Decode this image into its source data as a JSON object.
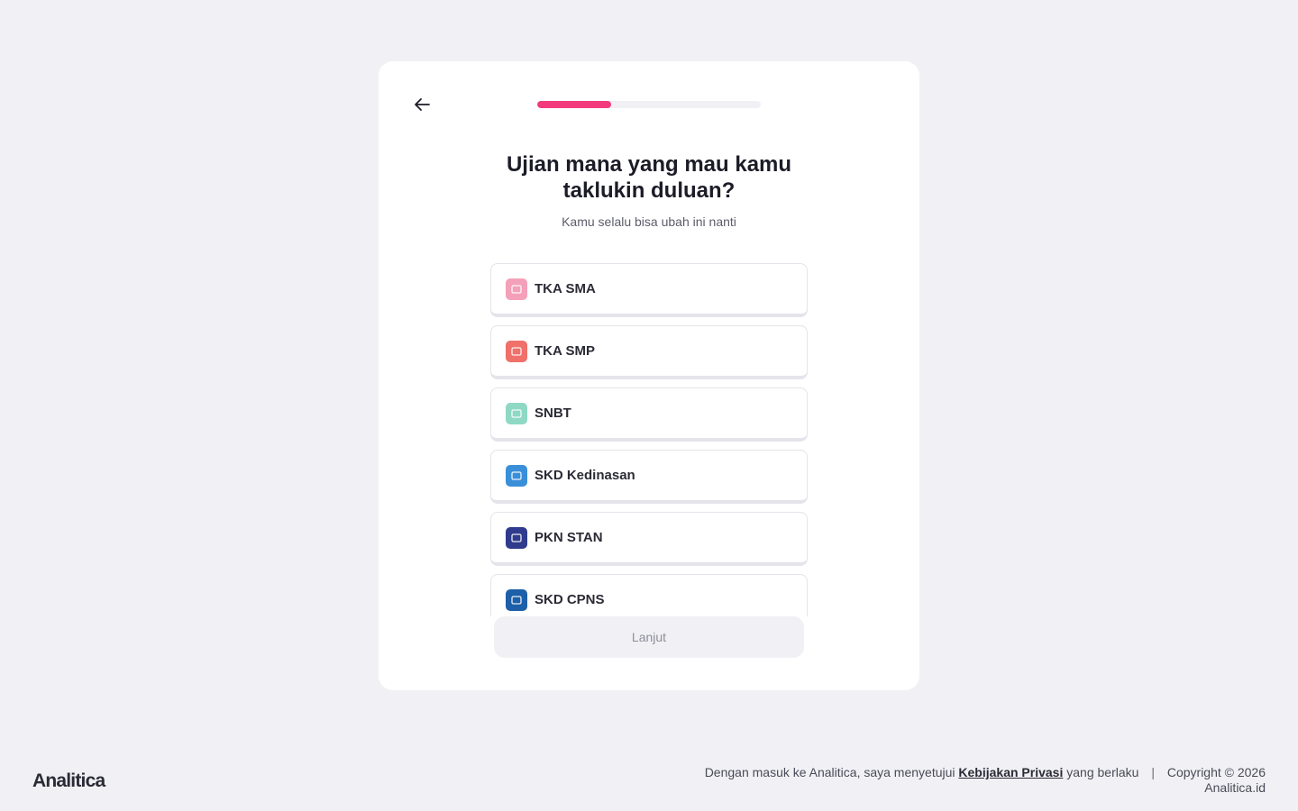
{
  "header": {
    "back_icon": "arrow-left-icon",
    "progress_fraction": 0.33,
    "progress_color": "#f23a7d"
  },
  "question": {
    "title": "Ujian mana yang mau kamu taklukin duluan?",
    "subtitle": "Kamu selalu bisa ubah ini nanti"
  },
  "options": [
    {
      "label": "TKA SMA",
      "icon": "tka-sma-icon",
      "color": "#f4a0b8"
    },
    {
      "label": "TKA SMP",
      "icon": "tka-smp-icon",
      "color": "#f0706a"
    },
    {
      "label": "SNBT",
      "icon": "snbt-icon",
      "color": "#8fd9c4"
    },
    {
      "label": "SKD Kedinasan",
      "icon": "skd-kedinasan-icon",
      "color": "#3a8fd9"
    },
    {
      "label": "PKN STAN",
      "icon": "pkn-stan-icon",
      "color": "#2f3b8c"
    },
    {
      "label": "SKD CPNS",
      "icon": "skd-cpns-icon",
      "color": "#1d5fa8"
    }
  ],
  "actions": {
    "continue_label": "Lanjut"
  },
  "footer": {
    "brand": "Analitica",
    "consent_prefix": "Dengan masuk ke Analitica, saya menyetujui",
    "privacy_link": "Kebijakan Privasi",
    "consent_suffix": "yang berlaku",
    "separator": "|",
    "copyright": "Copyright © 2026 Analitica.id"
  }
}
